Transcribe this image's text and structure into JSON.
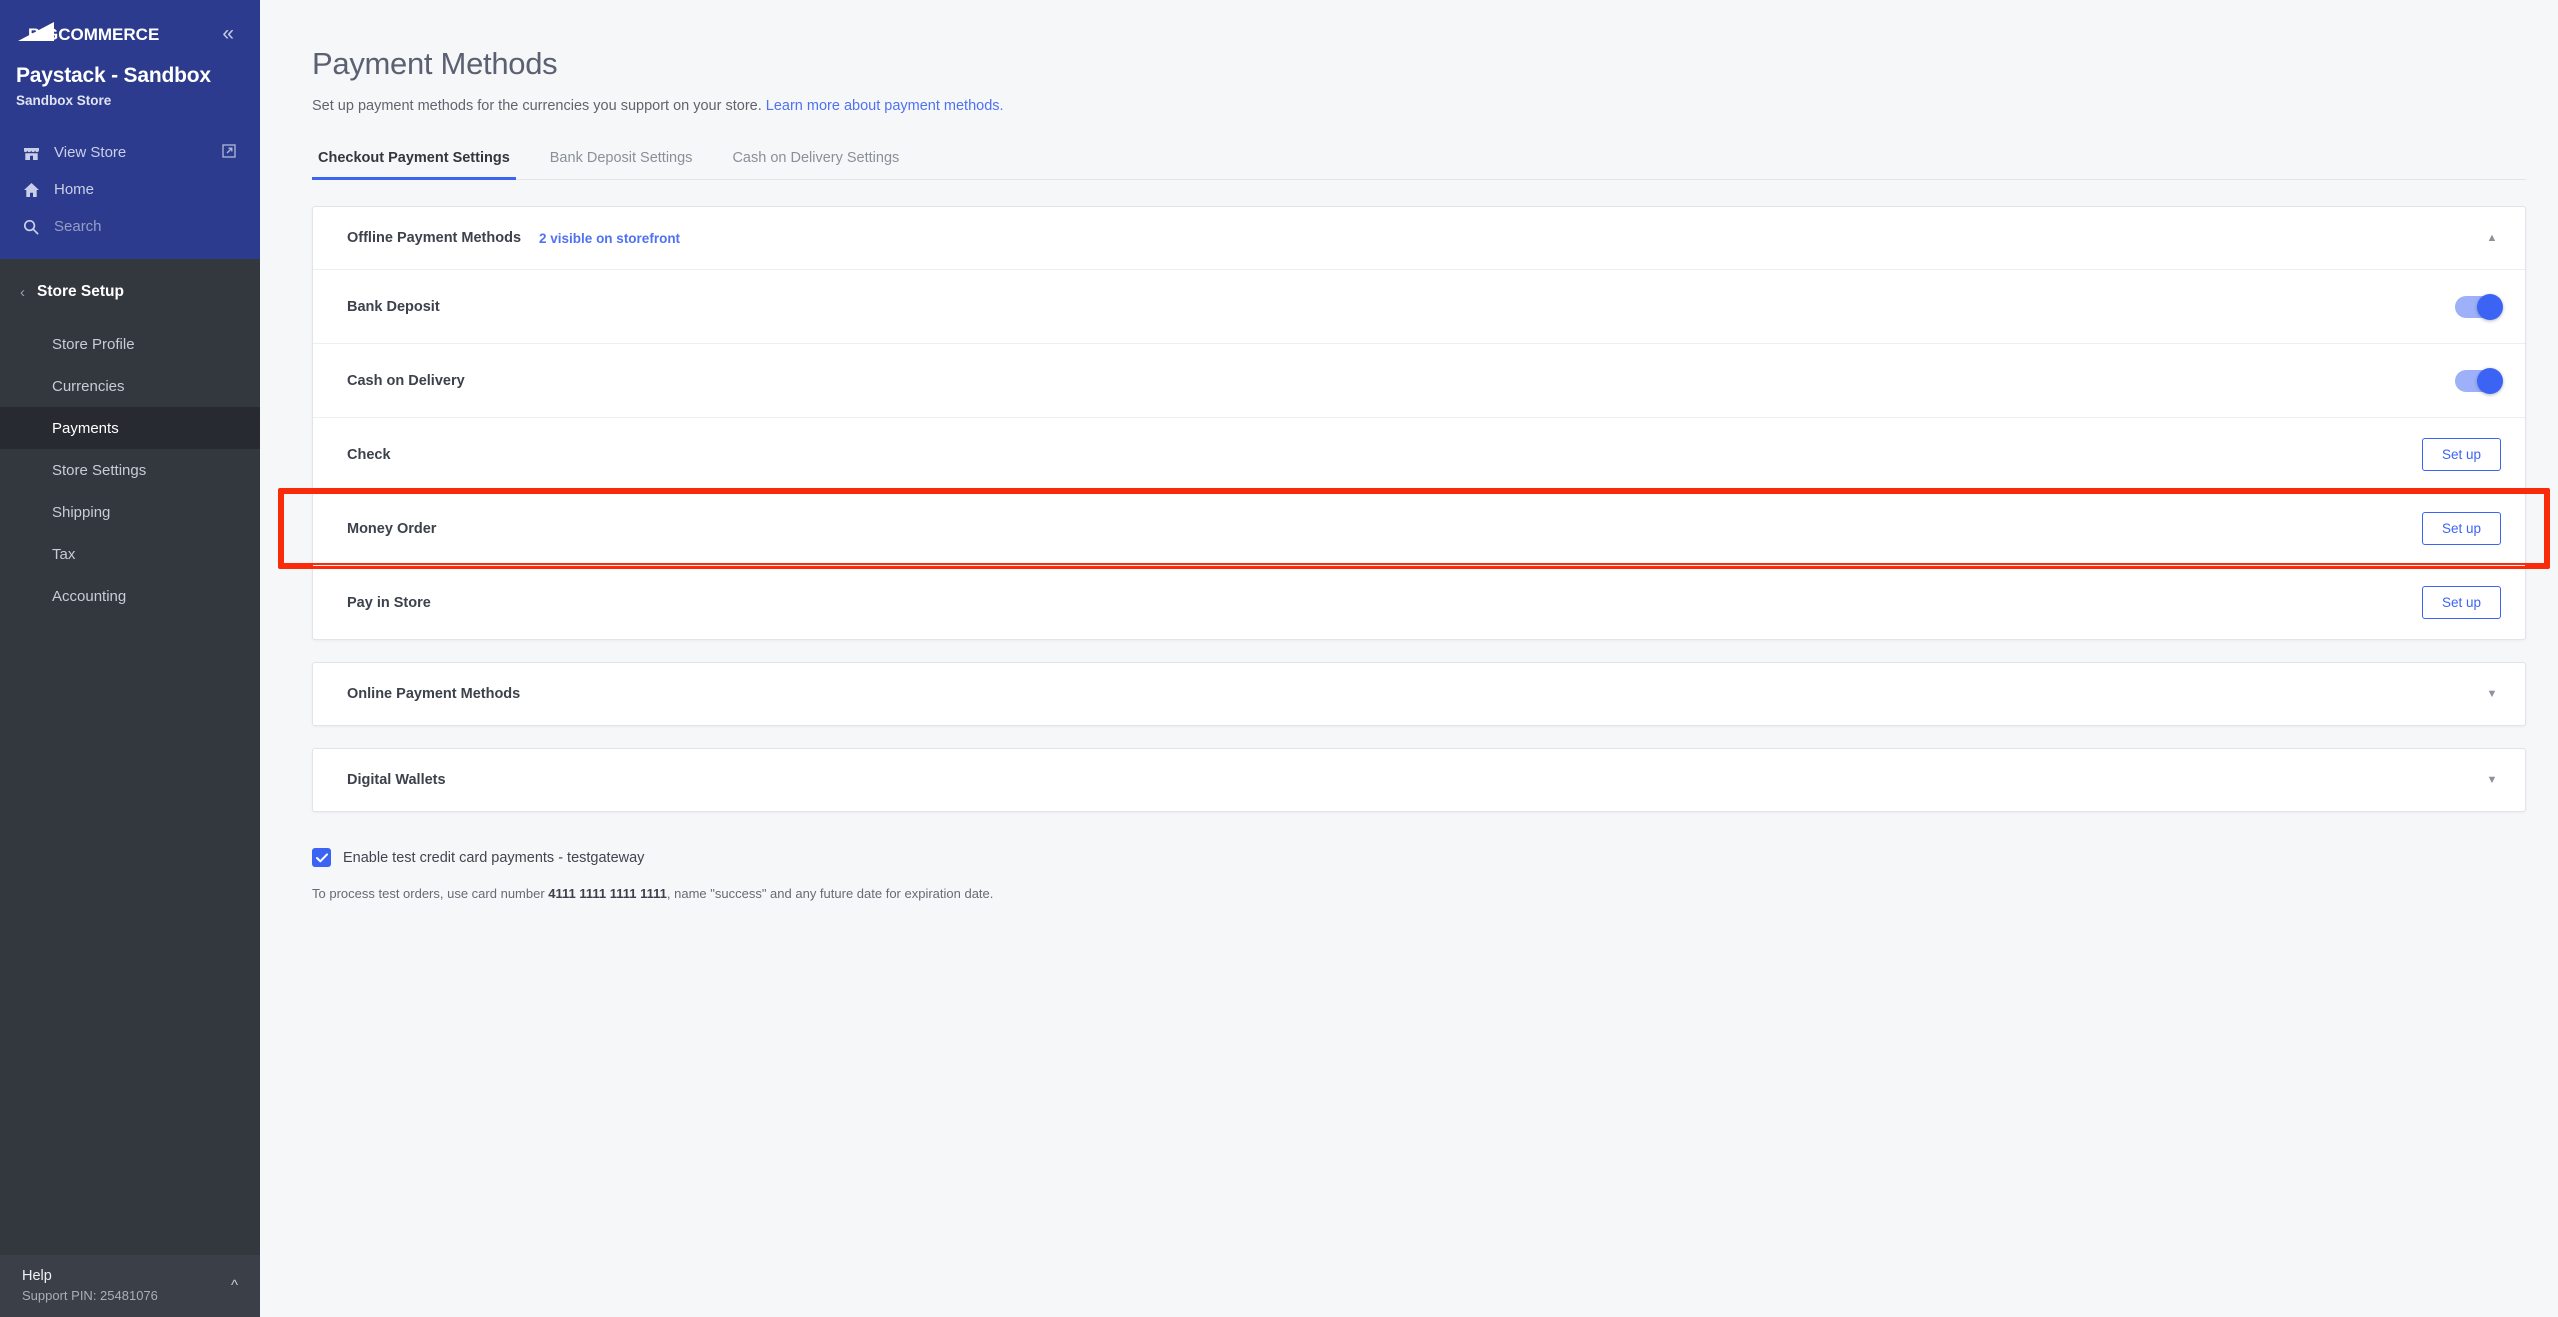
{
  "sidebar": {
    "brand": "BIGCOMMERCE",
    "collapse_icon": "chevron-double-left-icon",
    "store_name": "Paystack - Sandbox",
    "store_subtitle": "Sandbox Store",
    "links": [
      {
        "label": "View Store",
        "icon": "storefront-icon",
        "trailing_icon": "external-link-icon"
      },
      {
        "label": "Home",
        "icon": "home-icon"
      },
      {
        "label": "Search",
        "icon": "search-icon"
      }
    ],
    "section": {
      "label": "Store Setup",
      "back_icon": "chevron-left-icon"
    },
    "items": [
      {
        "label": "Store Profile",
        "active": false
      },
      {
        "label": "Currencies",
        "active": false
      },
      {
        "label": "Payments",
        "active": true
      },
      {
        "label": "Store Settings",
        "active": false
      },
      {
        "label": "Shipping",
        "active": false
      },
      {
        "label": "Tax",
        "active": false
      },
      {
        "label": "Accounting",
        "active": false
      }
    ],
    "footer": {
      "title": "Help",
      "support_pin": "Support PIN: 25481076",
      "chevron_icon": "chevron-up-icon"
    }
  },
  "page": {
    "title": "Payment Methods",
    "subtitle_text": "Set up payment methods for the currencies you support on your store.",
    "subtitle_link": "Learn more about payment methods."
  },
  "tabs": [
    {
      "label": "Checkout Payment Settings",
      "active": true
    },
    {
      "label": "Bank Deposit Settings",
      "active": false
    },
    {
      "label": "Cash on Delivery Settings",
      "active": false
    }
  ],
  "offline_card": {
    "title": "Offline Payment Methods",
    "badge": "2 visible on storefront",
    "caret_icon": "caret-up-icon",
    "rows": [
      {
        "name": "Bank Deposit",
        "control": "toggle",
        "toggle_on": true,
        "highlighted": false
      },
      {
        "name": "Cash on Delivery",
        "control": "toggle",
        "toggle_on": true,
        "highlighted": false
      },
      {
        "name": "Check",
        "control": "button",
        "button_label": "Set up",
        "highlighted": false
      },
      {
        "name": "Money Order",
        "control": "button",
        "button_label": "Set up",
        "highlighted": true
      },
      {
        "name": "Pay in Store",
        "control": "button",
        "button_label": "Set up",
        "highlighted": false
      }
    ]
  },
  "collapsed_cards": [
    {
      "title": "Online Payment Methods",
      "caret_icon": "caret-down-icon"
    },
    {
      "title": "Digital Wallets",
      "caret_icon": "caret-down-icon"
    }
  ],
  "test_gateway": {
    "checked": true,
    "label": "Enable test credit card payments - testgateway",
    "help_prefix": "To process test orders, use card number ",
    "help_card_number": "4111 1111 1111 1111",
    "help_suffix": ", name \"success\" and any future date for expiration date."
  },
  "colors": {
    "brand_blue": "#2c3b8d",
    "accent_blue": "#3c64f4",
    "link_blue": "#5072f2",
    "sidebar_dark": "#33373e",
    "highlight_red": "#f92b0b"
  }
}
